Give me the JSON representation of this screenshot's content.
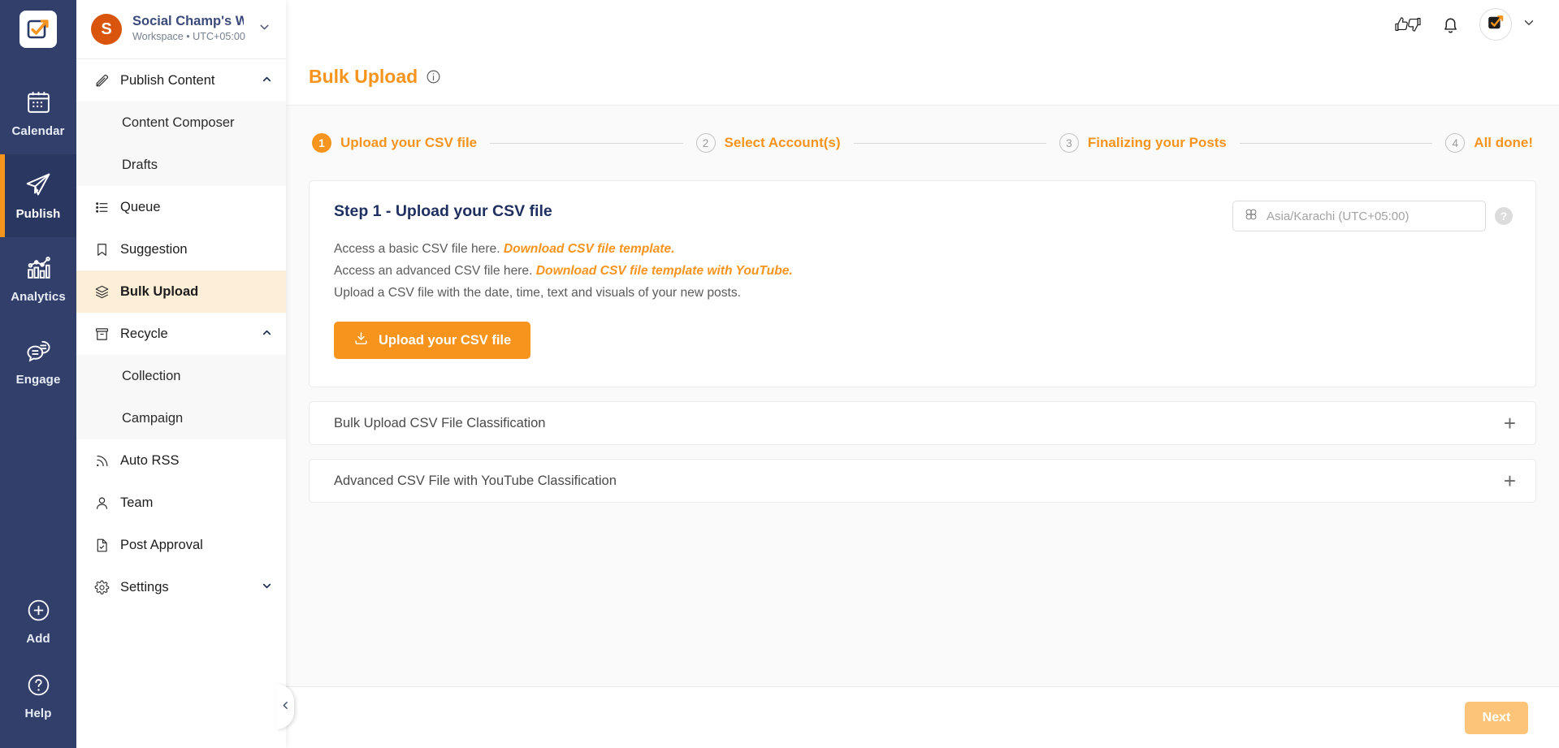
{
  "brand": {
    "accent": "#f7941d",
    "navy": "#323f6b",
    "avatar_color": "#d9550d"
  },
  "rail": {
    "logo_icon": "social-champ-logo-icon",
    "items": [
      {
        "label": "Calendar",
        "icon": "calendar-icon",
        "active": false
      },
      {
        "label": "Publish",
        "icon": "paper-plane-icon",
        "active": true
      },
      {
        "label": "Analytics",
        "icon": "bar-chart-icon",
        "active": false
      },
      {
        "label": "Engage",
        "icon": "chat-bubbles-icon",
        "active": false
      }
    ],
    "bottom_items": [
      {
        "label": "Add",
        "icon": "plus-circle-icon"
      },
      {
        "label": "Help",
        "icon": "question-circle-icon"
      }
    ]
  },
  "workspace": {
    "avatar_letter": "S",
    "name": "Social Champ's W...",
    "subtitle": "Workspace • UTC+05:00",
    "caret_icon": "chevron-down-icon"
  },
  "menu": {
    "items": [
      {
        "label": "Publish Content",
        "icon": "pencil-icon",
        "level": "parent",
        "expanded": true,
        "chevron": "chevron-up-icon"
      },
      {
        "label": "Content Composer",
        "icon": "",
        "level": "child"
      },
      {
        "label": "Drafts",
        "icon": "",
        "level": "child"
      },
      {
        "label": "Queue",
        "icon": "list-icon",
        "level": "top"
      },
      {
        "label": "Suggestion",
        "icon": "bookmark-icon",
        "level": "top"
      },
      {
        "label": "Bulk Upload",
        "icon": "layers-icon",
        "level": "top",
        "active": true
      },
      {
        "label": "Recycle",
        "icon": "archive-icon",
        "level": "parent",
        "expanded": true,
        "chevron": "chevron-up-icon"
      },
      {
        "label": "Collection",
        "icon": "",
        "level": "child"
      },
      {
        "label": "Campaign",
        "icon": "",
        "level": "child"
      },
      {
        "label": "Auto RSS",
        "icon": "rss-icon",
        "level": "top"
      },
      {
        "label": "Team",
        "icon": "user-icon",
        "level": "top"
      },
      {
        "label": "Post Approval",
        "icon": "document-check-icon",
        "level": "top"
      },
      {
        "label": "Settings",
        "icon": "gear-icon",
        "level": "parent",
        "expanded": false,
        "chevron": "chevron-down-icon"
      }
    ]
  },
  "topbar": {
    "feedback_icon": "thumbs-up-down-icon",
    "notifications_icon": "bell-icon",
    "profile_icon": "social-champ-logo-icon",
    "profile_caret_icon": "chevron-down-icon"
  },
  "page": {
    "title": "Bulk Upload",
    "info_icon": "info-circle-icon"
  },
  "stepper": {
    "steps": [
      {
        "num": "1",
        "label": "Upload your CSV file",
        "state": "done"
      },
      {
        "num": "2",
        "label": "Select Account(s)",
        "state": "todo"
      },
      {
        "num": "3",
        "label": "Finalizing your Posts",
        "state": "todo"
      },
      {
        "num": "4",
        "label": "All done!",
        "state": "todo"
      }
    ]
  },
  "upload_card": {
    "title": "Step 1 - Upload your CSV file",
    "line1_text": "Access a basic CSV file here.",
    "line1_link": "Download CSV file template.",
    "line2_text": "Access an advanced CSV file here.",
    "line2_link": "Download CSV file template with YouTube.",
    "line3_text": "Upload a CSV file with the date, time, text and visuals of your new posts.",
    "button_label": "Upload your CSV file",
    "button_icon": "download-tray-icon",
    "timezone_icon": "globe-group-icon",
    "timezone_value": "Asia/Karachi (UTC+05:00)",
    "help_label": "?"
  },
  "accordions": [
    {
      "title": "Bulk Upload CSV File Classification",
      "toggle": "+"
    },
    {
      "title": "Advanced CSV File with YouTube Classification",
      "toggle": "+"
    }
  ],
  "footer": {
    "next_label": "Next"
  },
  "collapse": {
    "icon": "chevron-left-icon"
  }
}
